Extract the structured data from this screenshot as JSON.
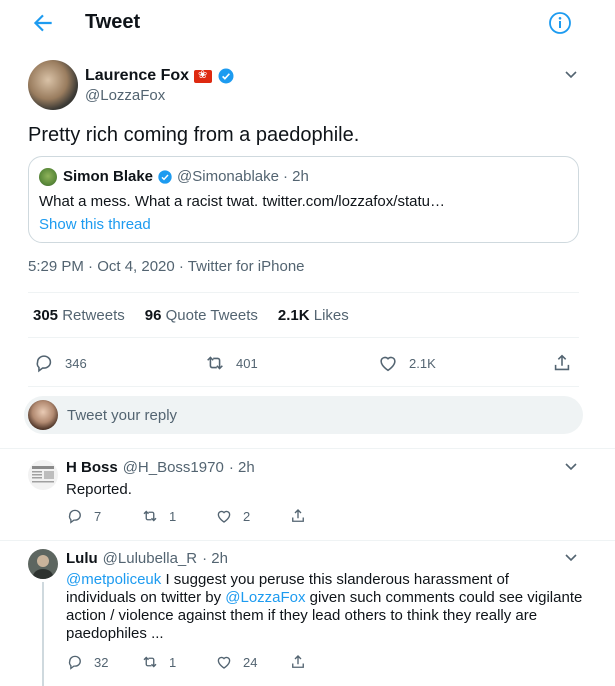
{
  "header": {
    "title": "Tweet"
  },
  "tweet": {
    "author_name": "Laurence Fox",
    "author_handle": "@LozzaFox",
    "text": "Pretty rich coming from a paedophile.",
    "quote": {
      "name": "Simon Blake",
      "handle": "@Simonablake",
      "time": "· 2h",
      "text": "What a mess. What a racist twat. twitter.com/lozzafox/statu…",
      "link": "Show this thread"
    },
    "meta": "5:29 PM · Oct 4, 2020 · Twitter for iPhone",
    "stats": {
      "retweets_count": "305",
      "retweets_label": "Retweets",
      "quotes_count": "96",
      "quotes_label": "Quote Tweets",
      "likes_count": "2.1K",
      "likes_label": "Likes"
    },
    "actions": {
      "replies": "346",
      "retweets": "401",
      "likes": "2.1K"
    }
  },
  "reply_box": {
    "placeholder": "Tweet your reply"
  },
  "replies": [
    {
      "name": "H Boss",
      "handle": "@H_Boss1970",
      "time": "· 2h",
      "text": "Reported.",
      "actions": {
        "replies": "7",
        "retweets": "1",
        "likes": "2"
      }
    },
    {
      "name": "Lulu",
      "handle": "@Lulubella_R",
      "time": "· 2h",
      "mention1": "@metpoliceuk",
      "text_part1": " I suggest you peruse this slanderous harassment of",
      "text_part2": "individuals on twitter by ",
      "mention2": "@LozzaFox",
      "text_part3": " given such comments could see vigilante",
      "text_part4": "action / violence against them if they lead others to think they really are",
      "text_part5": "paedophiles ...",
      "actions": {
        "replies": "32",
        "retweets": "1",
        "likes": "24"
      }
    }
  ],
  "colors": {
    "accent": "#1d9bf0",
    "secondary_text": "#536471",
    "border": "#cfd9de"
  }
}
